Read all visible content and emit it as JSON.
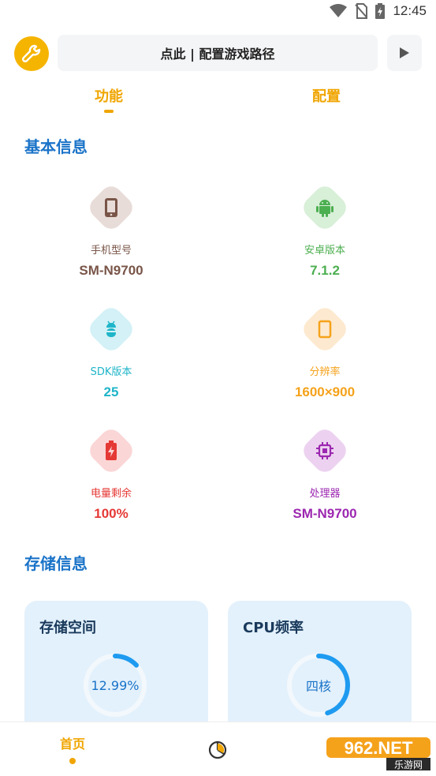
{
  "status_bar": {
    "time": "12:45",
    "icons": [
      "wifi-icon",
      "no-sim-icon",
      "battery-charging-icon"
    ]
  },
  "top_bar": {
    "logo_icon": "wrench-icon",
    "path_button_label": "点此 | 配置游戏路径",
    "play_icon": "play-icon"
  },
  "tabs": [
    {
      "label": "功能",
      "active": true
    },
    {
      "label": "配置",
      "active": false
    }
  ],
  "basic_info": {
    "title": "基本信息",
    "items": [
      {
        "label": "手机型号",
        "value": "SM-N9700",
        "icon": "phone-icon",
        "color": "#795548",
        "bg": "#e8dcd8"
      },
      {
        "label": "安卓版本",
        "value": "7.1.2",
        "icon": "android-icon",
        "color": "#4caf50",
        "bg": "#d8efd8"
      },
      {
        "label": "SDK版本",
        "value": "25",
        "icon": "android-bug-icon",
        "color": "#1fb5c9",
        "bg": "#d3f1f6"
      },
      {
        "label": "分辨率",
        "value": "1600×900",
        "icon": "screen-icon",
        "color": "#f5a21b",
        "bg": "#fde9cf"
      },
      {
        "label": "电量剩余",
        "value": "100%",
        "icon": "battery-icon",
        "color": "#e53935",
        "bg": "#fbd6d6"
      },
      {
        "label": "处理器",
        "value": "SM-N9700",
        "icon": "chip-icon",
        "color": "#9c27b0",
        "bg": "#ecd2f0"
      }
    ]
  },
  "storage_info": {
    "title": "存储信息",
    "cards": [
      {
        "title": "存储空间",
        "gauge_text": "12.99%",
        "progress": 0.1299
      },
      {
        "title": "CPU频率",
        "gauge_text": "四核",
        "progress": 0.45
      }
    ]
  },
  "bottom_nav": {
    "home_label": "首页",
    "stats_icon": "pie-chart-icon"
  },
  "watermark": {
    "text": "962.NET",
    "subtext": "乐游网"
  },
  "colors": {
    "accent": "#f0a500",
    "title_blue": "#1a73c8",
    "gauge_blue": "#1e9bf0",
    "card_bg": "#e3f1fc"
  }
}
